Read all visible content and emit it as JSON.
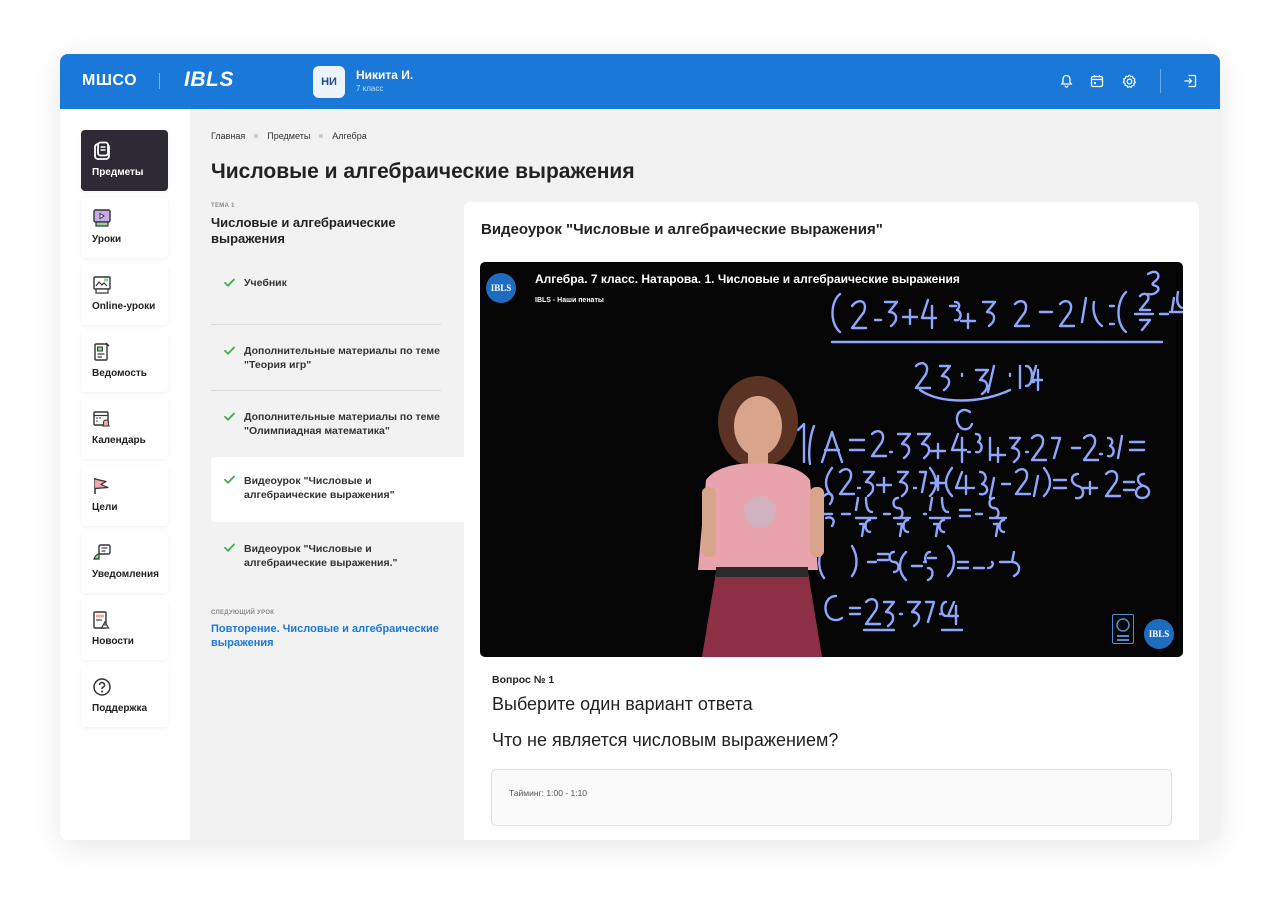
{
  "header": {
    "logo_primary": "МШСО",
    "logo_secondary": "IBLS",
    "user_initials": "НИ",
    "user_name": "Никита И.",
    "user_grade": "7 класс",
    "accent_color": "#1a78d8",
    "icons": [
      "bell-icon",
      "calendar-icon",
      "gear-icon",
      "logout-icon"
    ]
  },
  "sidebar": {
    "items": [
      {
        "label": "Предметы",
        "icon": "book-icon",
        "active": true
      },
      {
        "label": "Уроки",
        "icon": "video-lesson-icon",
        "active": false
      },
      {
        "label": "Online-уроки",
        "icon": "online-lesson-icon",
        "active": false
      },
      {
        "label": "Ведомость",
        "icon": "report-icon",
        "active": false
      },
      {
        "label": "Календарь",
        "icon": "calendar-bell-icon",
        "active": false
      },
      {
        "label": "Цели",
        "icon": "flag-icon",
        "active": false
      },
      {
        "label": "Уведомления",
        "icon": "notification-icon",
        "active": false
      },
      {
        "label": "Новости",
        "icon": "news-icon",
        "active": false
      },
      {
        "label": "Поддержка",
        "icon": "help-icon",
        "active": false
      }
    ]
  },
  "breadcrumb": [
    "Главная",
    "Предметы",
    "Алгебра"
  ],
  "page_title": "Числовые и алгебраические выражения",
  "topic": {
    "kicker": "ТЕМА 1",
    "title": "Числовые и алгебраические выражения",
    "lessons": [
      {
        "label": "Учебник",
        "completed": true
      },
      {
        "label": "Дополнительные материалы по теме \"Теория игр\"",
        "completed": true
      },
      {
        "label": "Дополнительные материалы по теме \"Олимпиадная математика\"",
        "completed": true
      },
      {
        "label": "Видеоурок \"Числовые и алгебраические выражения\"",
        "completed": true,
        "active": true
      },
      {
        "label": "Видеоурок \"Числовые и алгебраические выражения.\"",
        "completed": true
      }
    ],
    "next_kicker": "СЛЕДУЮЩИЙ УРОК",
    "next_lesson": "Повторение. Числовые и алгебраические выражения"
  },
  "content": {
    "title": "Видеоурок \"Числовые и алгебраические выражения\"",
    "video": {
      "title": "Алгебра. 7 класс. Натарова. 1. Числовые и алгебраические выражения",
      "channel": "IBLS - Наши пенаты",
      "badge": "IBLS"
    },
    "question_number": "Вопрос № 1",
    "question_type": "Выберите один вариант ответа",
    "question_text": "Что не является числовым выражением?",
    "timing": "Тайминг: 1:00 - 1:10"
  }
}
